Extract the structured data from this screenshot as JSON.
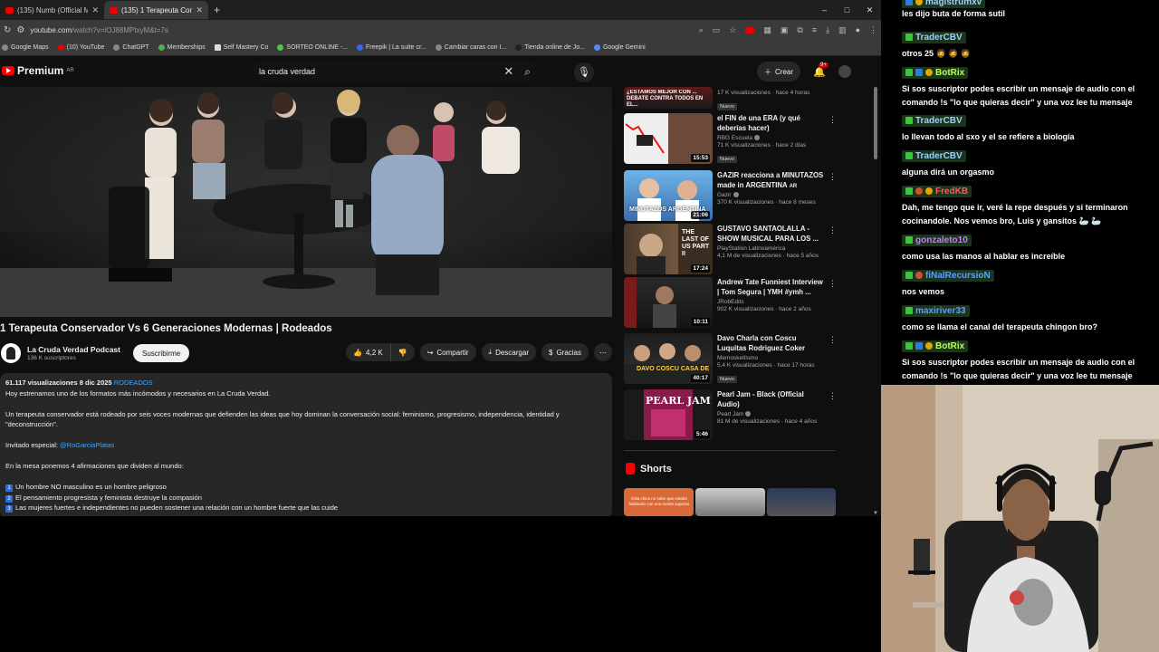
{
  "browser": {
    "tabs": [
      {
        "label": "(135) Numb (Official Music Vide",
        "active": false
      },
      {
        "label": "(135) 1 Terapeuta Conservado",
        "active": true
      }
    ],
    "window_controls": [
      "–",
      "□",
      "✕"
    ],
    "url_host": "youtube.com",
    "url_path": "/watch?v=lOJ88MPtxyM&t=7s",
    "bookmarks": [
      "Google Maps",
      "(10) YouTube",
      "ChatGPT",
      "Memberships",
      "Self Mastery Co",
      "SORTEO ONLINE -...",
      "Freepik | La suite cr...",
      "Cambiar caras con I...",
      "Tienda online de Jo...",
      "Google Gemini"
    ]
  },
  "youtube": {
    "logo_text": "Premium",
    "logo_region": "AR",
    "search_value": "la cruda verdad",
    "create_label": "Crear",
    "notif_count": "9+",
    "video_title": "1 Terapeuta Conservador Vs 6 Generaciones Modernas | Rodeados",
    "channel": {
      "name": "La Cruda Verdad Podcast",
      "subs": "136 K suscriptores",
      "subscribe_label": "Suscribirme"
    },
    "actions": {
      "likes": "4,2 K",
      "share": "Compartir",
      "download": "Descargar",
      "thanks": "Gracias"
    },
    "description": {
      "views": "61.117 visualizaciones",
      "date": "8 dic 2025",
      "tag": "RODEADOS",
      "lines": [
        "Hoy estrenamos uno de los formatos más incómodos y necesarios en La Cruda Verdad.",
        "",
        "Un terapeuta conservador está rodeado por seis voces modernas que defienden las ideas que hoy dominan la conversación social: feminismo, progresismo, independencia, identidad y \"deconstrucción\".",
        "",
        "Invitado especial: ",
        "",
        "En la mesa ponemos 4 afirmaciones que dividen al mundo:",
        ""
      ],
      "guest_link": "@RoGarciaPlatas",
      "points": [
        {
          "num": "1",
          "text": "Un hombre NO masculino es un hombre peligroso"
        },
        {
          "num": "2",
          "text": "El pensamiento progresista y feminista destruye la compasión"
        },
        {
          "num": "3",
          "text": "Las mujeres fuertes e independientes no pueden sostener una relación con un hombre fuerte que las cuide"
        }
      ]
    },
    "related": [
      {
        "title": "",
        "channel": "",
        "meta": "17 K visualizaciones · hace 4 horas",
        "duration": "",
        "badge": "Nuevo",
        "thumb_text": "¿ESTAMOS MEJOR CON ... DEBATE CONTRA TODOS EN EL..."
      },
      {
        "title": "el FIN de una ERA (y qué deberías hacer)",
        "channel": "RBG Escuela",
        "meta": "71 K visualizaciones · hace 2 días",
        "duration": "15:53",
        "badge": "Nuevo",
        "thumb_text": ""
      },
      {
        "title": "GAZIR reacciona a MINUTAZOS made in ARGENTINA",
        "title_suffix": "AR",
        "channel": "Gazir",
        "meta": "370 K visualizaciones · hace 8 meses",
        "duration": "21:06",
        "badge": "",
        "thumb_text": "MINUTAZOS ARGENTINA"
      },
      {
        "title": "GUSTAVO SANTAOLALLA - SHOW MUSICAL PARA LOS ...",
        "channel": "PlayStation Latinoamérica",
        "meta": "4,1 M de visualizaciones · hace 5 años",
        "duration": "17:24",
        "badge": "",
        "thumb_text": "THE LAST OF US PART II"
      },
      {
        "title": "Andrew Tate Funniest Interview | Tom Segura | YMH #ymh ...",
        "channel": "JRobEdits",
        "meta": "902 K visualizaciones · hace 2 años",
        "duration": "10:11",
        "badge": "",
        "thumb_text": ""
      },
      {
        "title": "Davo Charla con Coscu Luquitas Rodriguez Coker Zek...",
        "channel": "Memosketlismo",
        "meta": "5,4 K visualizaciones · hace 17 horas",
        "duration": "40:17",
        "badge": "Nuevo",
        "thumb_text": "DAVO COSCU CASA DE"
      },
      {
        "title": "Pearl Jam - Black (Official Audio)",
        "channel": "Pearl Jam",
        "meta": "81 M de visualizaciones · hace 4 años",
        "duration": "5:46",
        "badge": "",
        "thumb_text": "PEARL JAM"
      }
    ],
    "shorts_label": "Shorts",
    "shorts_first_text": "Esta chica no sabe que estaba hablando con una mente superior"
  },
  "chat": [
    {
      "user": "magistrumxv",
      "color": "#9bd0ff",
      "badges": [
        "b"
      ],
      "text": "les dijo buta de forma sutil"
    },
    {
      "user": "TraderCBV",
      "color": "#9bd0ff",
      "badges": [
        "g"
      ],
      "text": "otros 25 🧔 🧔 🧔"
    },
    {
      "user": "BotRix",
      "color": "#b8ff5a",
      "badges": [
        "g",
        "b",
        "y"
      ],
      "text_lines": [
        "Si sos suscriptor podes escribir un mensaje de audio con el",
        "comando !s \"lo que quieras decir\" y una voz lee tu mensaje"
      ]
    },
    {
      "user": "TraderCBV",
      "color": "#9bd0ff",
      "badges": [
        "g"
      ],
      "text": "lo llevan todo al sxo y el se refiere a biología"
    },
    {
      "user": "TraderCBV",
      "color": "#9bd0ff",
      "badges": [
        "g"
      ],
      "text": "alguna dirá un orgasmo"
    },
    {
      "user": "FredKB",
      "color": "#ff5a5a",
      "badges": [
        "g",
        "p",
        "y"
      ],
      "text_lines": [
        "Dah, me tengo que ir, veré la repe después y si terminaron",
        "cocinandole. Nos vemos bro, Luis y gansitos 🦢 🦢"
      ]
    },
    {
      "user": "gonzaleto10",
      "color": "#c47cff",
      "badges": [
        "g"
      ],
      "text": "como usa las manos al hablar es increíble"
    },
    {
      "user": "fiNalRecursioN",
      "color": "#5aa0ff",
      "badges": [
        "g",
        "p"
      ],
      "text": "nos vemos"
    },
    {
      "user": "maxiriver33",
      "color": "#5aa0ff",
      "badges": [
        "g"
      ],
      "text": "como se llama el canal del terapeuta chingon bro?"
    },
    {
      "user": "BotRix",
      "color": "#b8ff5a",
      "badges": [
        "g",
        "b",
        "y"
      ],
      "text_lines": [
        "Si sos suscriptor podes escribir un mensaje de audio con el",
        "comando !s \"lo que quieras decir\" y una voz lee tu mensaje"
      ]
    }
  ]
}
